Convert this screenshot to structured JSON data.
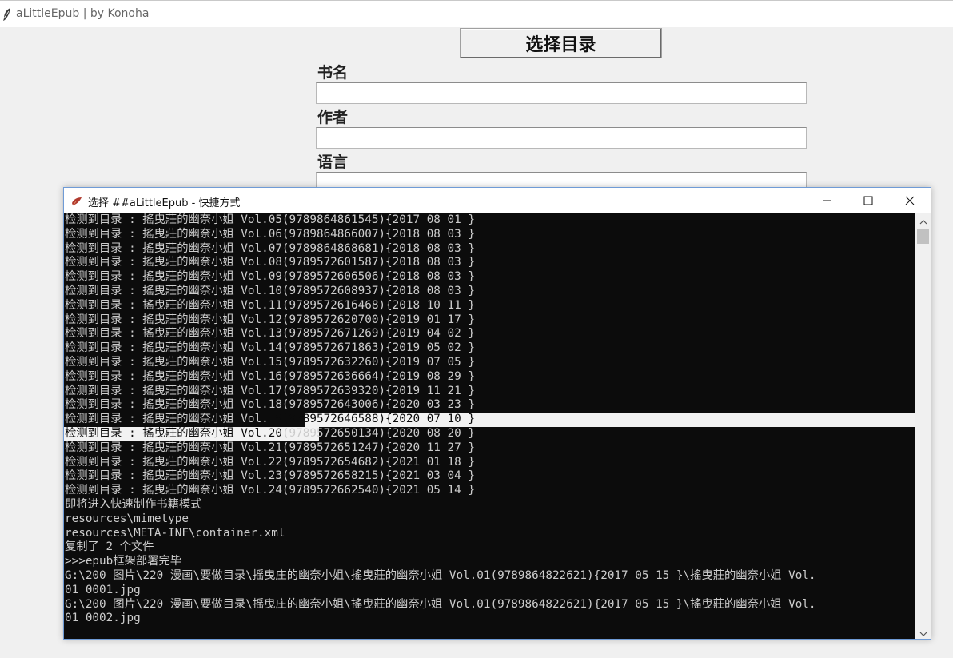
{
  "app": {
    "title": "aLittleEpub  |  by Konoha",
    "select_button": "选择目录",
    "fields": [
      {
        "label": "书名",
        "value": ""
      },
      {
        "label": "作者",
        "value": ""
      },
      {
        "label": "语言",
        "value": ""
      }
    ]
  },
  "console": {
    "title": "选择 ##aLittleEpub - 快捷方式",
    "lines": [
      "检测到目录 : 搖曳莊的幽奈小姐 Vol.05(9789864861545){2017 08 01 }",
      "检测到目录 : 搖曳莊的幽奈小姐 Vol.06(9789864866007){2018 08 03 }",
      "检测到目录 : 搖曳莊的幽奈小姐 Vol.07(9789864868681){2018 08 03 }",
      "检测到目录 : 搖曳莊的幽奈小姐 Vol.08(9789572601587){2018 08 03 }",
      "检测到目录 : 搖曳莊的幽奈小姐 Vol.09(9789572606506){2018 08 03 }",
      "检测到目录 : 搖曳莊的幽奈小姐 Vol.10(9789572608937){2018 08 03 }",
      "检测到目录 : 搖曳莊的幽奈小姐 Vol.11(9789572616468){2018 10 11 }",
      "检测到目录 : 搖曳莊的幽奈小姐 Vol.12(9789572620700){2019 01 17 }",
      "检测到目录 : 搖曳莊的幽奈小姐 Vol.13(9789572671269){2019 04 02 }",
      "检测到目录 : 搖曳莊的幽奈小姐 Vol.14(9789572671863){2019 05 02 }",
      "检测到目录 : 搖曳莊的幽奈小姐 Vol.15(9789572632260){2019 07 05 }",
      "检测到目录 : 搖曳莊的幽奈小姐 Vol.16(9789572636664){2019 08 29 }",
      "检测到目录 : 搖曳莊的幽奈小姐 Vol.17(9789572639320){2019 11 21 }",
      "检测到目录 : 搖曳莊的幽奈小姐 Vol.18(9789572643006){2020 03 23 }"
    ],
    "line19_head": "检测到目录 : 搖曳莊的幽奈小姐 Vol.",
    "line19_tail": "19(9789572646588){2020 07 10 }",
    "line20_head": "检测到目录 : 搖曳莊的幽奈小姐 Vol.20",
    "line20_tail": "(9789572650134){2020 08 20 }",
    "lines_after": [
      "检测到目录 : 搖曳莊的幽奈小姐 Vol.21(9789572651247){2020 11 27 }",
      "检测到目录 : 搖曳莊的幽奈小姐 Vol.22(9789572654682){2021 01 18 }",
      "检测到目录 : 搖曳莊的幽奈小姐 Vol.23(9789572658215){2021 03 04 }",
      "检测到目录 : 搖曳莊的幽奈小姐 Vol.24(9789572662540){2021 05 14 }",
      "即将进入快速制作书籍模式",
      "resources\\mimetype",
      "resources\\META-INF\\container.xml",
      "复制了 2 个文件",
      ">>>epub框架部署完毕",
      "G:\\200 图片\\220 漫画\\要做目录\\摇曳庄的幽奈小姐\\搖曳莊的幽奈小姐 Vol.01(9789864822621){2017 05 15 }\\搖曳莊的幽奈小姐 Vol.",
      "01_0001.jpg",
      "G:\\200 图片\\220 漫画\\要做目录\\摇曳庄的幽奈小姐\\搖曳莊的幽奈小姐 Vol.01(9789864822621){2017 05 15 }\\搖曳莊的幽奈小姐 Vol.",
      "01_0002.jpg"
    ]
  },
  "icons": {
    "app": "feather-icon",
    "console": "console-app-icon",
    "minimize": "minimize-icon",
    "maximize": "maximize-icon",
    "close": "close-icon",
    "scroll_up": "chevron-up-icon",
    "scroll_down": "chevron-down-icon"
  },
  "colors": {
    "console_bg": "#0c0c0c",
    "console_text": "#cccccc",
    "selection": "#f2f2f2"
  }
}
